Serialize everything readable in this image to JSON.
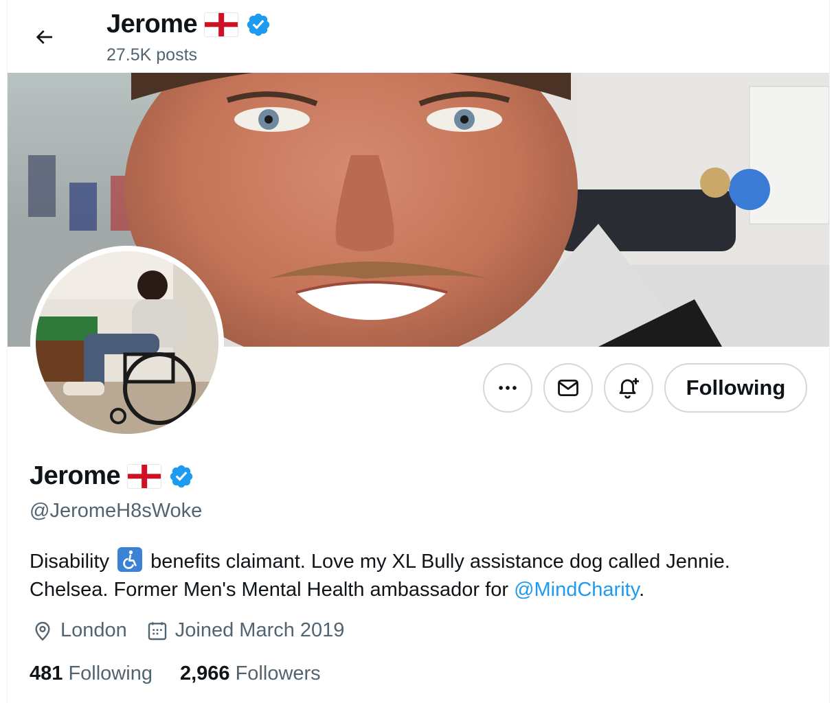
{
  "header": {
    "name": "Jerome",
    "posts": "27.5K posts"
  },
  "profile": {
    "name": "Jerome",
    "handle": "@JeromeH8sWoke",
    "bio_part1": "Disability",
    "bio_part2": "benefits claimant. Love my XL Bully assistance dog called Jennie. Chelsea. Former Men's Mental Health ambassador for",
    "bio_mention": "@MindCharity",
    "bio_end": ".",
    "location": "London",
    "joined": "Joined March 2019",
    "following_count": "481",
    "following_label": "Following",
    "followers_count": "2,966",
    "followers_label": "Followers"
  },
  "actions": {
    "more_label": "More",
    "message_label": "Message",
    "notify_label": "Turn on post notifications",
    "follow_button_label": "Following"
  },
  "icons": {
    "back": "arrow-left-icon",
    "verified": "verified-badge-icon",
    "flag": "england-flag-icon",
    "accessibility": "wheelchair-icon",
    "location": "location-pin-icon",
    "calendar": "calendar-icon",
    "more": "more-dots-icon",
    "message": "envelope-icon",
    "notify": "bell-plus-icon"
  },
  "colors": {
    "accent": "#1d9bf0",
    "text_primary": "#0f1419",
    "text_secondary": "#536471",
    "border": "#cfd9de",
    "flag_red": "#ce1124"
  }
}
